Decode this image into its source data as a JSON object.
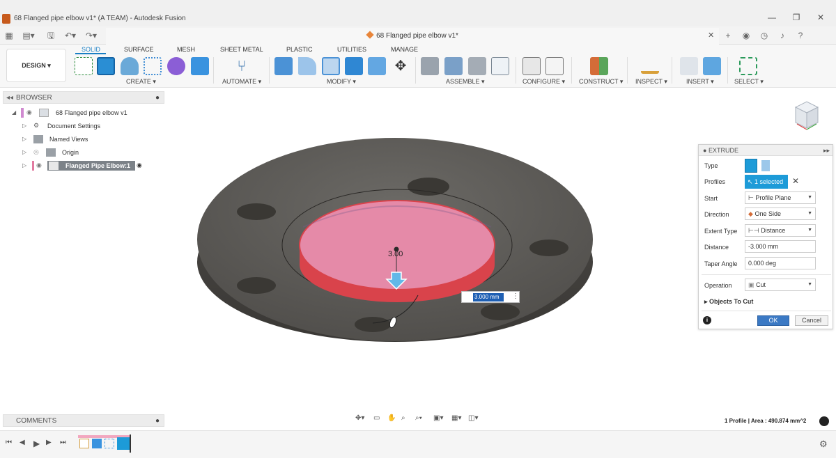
{
  "window": {
    "title": "68 Flanged pipe elbow v1* (A TEAM) - Autodesk Fusion"
  },
  "doc_tab": {
    "label": "68 Flanged pipe elbow v1*"
  },
  "workspace": {
    "label": "DESIGN ▾"
  },
  "tabs": [
    "SOLID",
    "SURFACE",
    "MESH",
    "SHEET METAL",
    "PLASTIC",
    "UTILITIES",
    "MANAGE"
  ],
  "groups": {
    "create": "CREATE ▾",
    "automate": "AUTOMATE ▾",
    "modify": "MODIFY ▾",
    "assemble": "ASSEMBLE ▾",
    "configure": "CONFIGURE ▾",
    "construct": "CONSTRUCT ▾",
    "inspect": "INSPECT ▾",
    "insert": "INSERT ▾",
    "select": "SELECT ▾"
  },
  "browser": {
    "title": "BROWSER",
    "root": "68 Flanged pipe elbow v1",
    "items": [
      "Document Settings",
      "Named Views",
      "Origin",
      "Flanged Pipe Elbow:1"
    ]
  },
  "viewport": {
    "dim_text": "3.00",
    "dim_input": "3.000 mm"
  },
  "extrude": {
    "title": "EXTRUDE",
    "labels": {
      "type": "Type",
      "profiles": "Profiles",
      "start": "Start",
      "direction": "Direction",
      "extent_type": "Extent Type",
      "distance": "Distance",
      "taper": "Taper Angle",
      "operation": "Operation"
    },
    "values": {
      "profiles": "1 selected",
      "start": "Profile Plane",
      "direction": "One Side",
      "extent_type": "Distance",
      "distance": "-3.000 mm",
      "taper": "0.000 deg",
      "operation": "Cut"
    },
    "objects_to_cut": "Objects To Cut",
    "ok": "OK",
    "cancel": "Cancel"
  },
  "comments": {
    "title": "COMMENTS"
  },
  "status": {
    "text": "1 Profile | Area : 490.874 mm^2"
  },
  "colors": {
    "accent": "#1a7fc4",
    "selection": "#1d9bd8",
    "cut_face": "#e58aa8",
    "cut_wall": "#d9434b",
    "metal": "#5c5a56"
  }
}
